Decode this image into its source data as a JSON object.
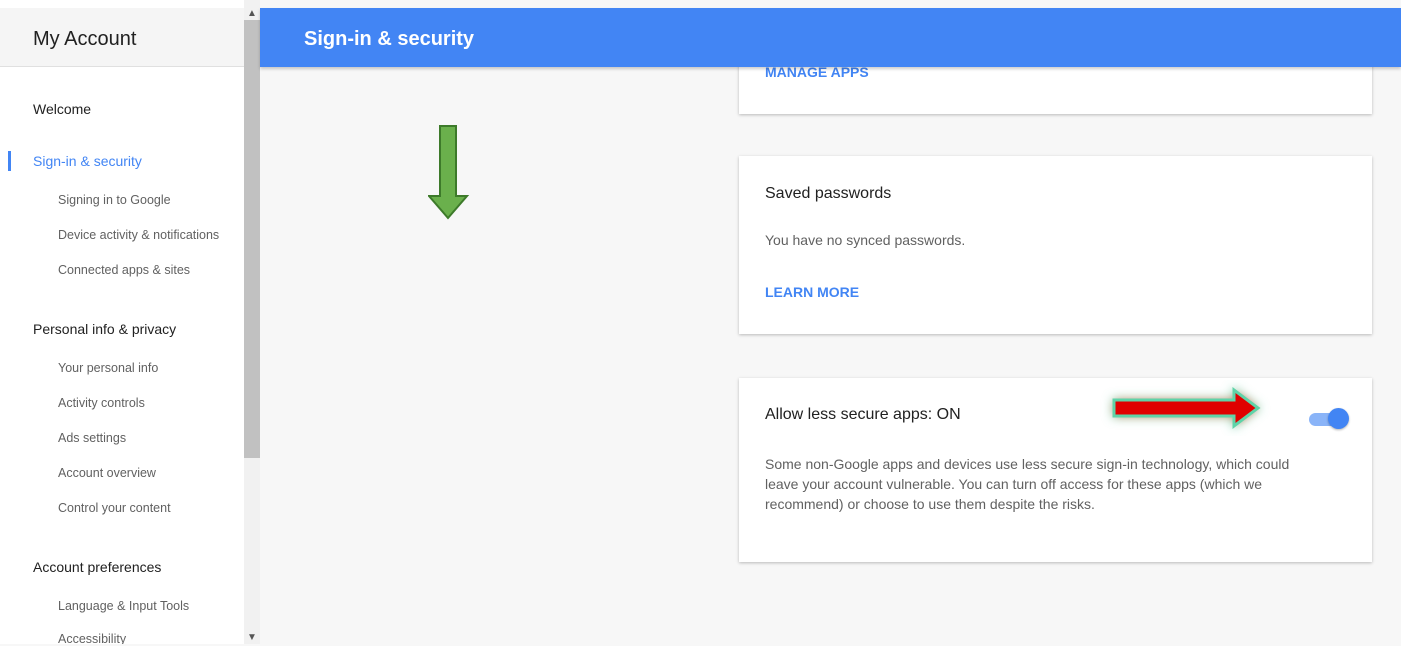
{
  "sidebar": {
    "title": "My Account",
    "sections": [
      {
        "label": "Welcome"
      },
      {
        "label": "Sign-in & security",
        "active": true,
        "items": [
          "Signing in to Google",
          "Device activity & notifications",
          "Connected apps & sites"
        ]
      },
      {
        "label": "Personal info & privacy",
        "items": [
          "Your personal info",
          "Activity controls",
          "Ads settings",
          "Account overview",
          "Control your content"
        ]
      },
      {
        "label": "Account preferences",
        "items": [
          "Language & Input Tools",
          "Accessibility"
        ]
      }
    ]
  },
  "topbar": {
    "title": "Sign-in & security"
  },
  "cards": {
    "manage_apps": {
      "link": "MANAGE APPS"
    },
    "saved_passwords": {
      "title": "Saved passwords",
      "text": "You have no synced passwords.",
      "link": "LEARN MORE"
    },
    "less_secure": {
      "title": "Allow less secure apps: ON",
      "description": "Some non-Google apps and devices use less secure sign-in technology, which could leave your account vulnerable. You can turn off access for these apps (which we recommend) or choose to use them despite the risks.",
      "toggle_on": true
    }
  },
  "icons": {
    "scroll_up": "▲",
    "scroll_down": "▼"
  },
  "colors": {
    "accent": "#4285f4",
    "annotation_green": "#6ab04c",
    "annotation_red": "#e00000"
  }
}
